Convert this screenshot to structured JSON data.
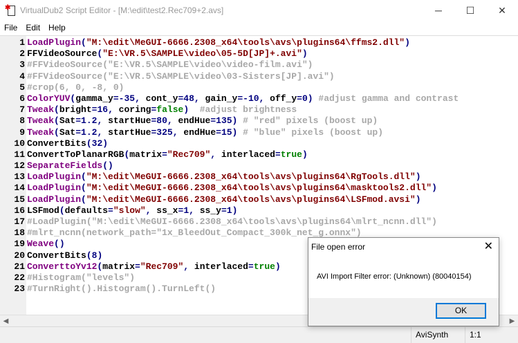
{
  "window": {
    "title": "VirtualDub2 Script Editor - [M:\\edit\\test2.Rec709+2.avs]",
    "minimize": "─",
    "maximize": "☐",
    "close": "✕"
  },
  "menu": [
    "File",
    "Edit",
    "Help"
  ],
  "lines": [
    {
      "num": "1",
      "tokens": [
        {
          "c": "fn",
          "t": "LoadPlugin"
        },
        {
          "c": "p",
          "t": "("
        },
        {
          "c": "s",
          "t": "\"M:\\edit\\MeGUI-6666.2308_x64\\tools\\avs\\plugins64\\ffms2.dll\""
        },
        {
          "c": "p",
          "t": ")"
        }
      ]
    },
    {
      "num": "2",
      "tokens": [
        {
          "c": "id",
          "t": "FFVideoSource"
        },
        {
          "c": "p",
          "t": "("
        },
        {
          "c": "s",
          "t": "\"E:\\VR.5\\SAMPLE\\video\\05-5D[JP]+.avi\""
        },
        {
          "c": "p",
          "t": ")"
        }
      ]
    },
    {
      "num": "3",
      "tokens": [
        {
          "c": "cm",
          "t": "#FFVideoSource(\"E:\\VR.5\\SAMPLE\\video\\video-film.avi\")"
        }
      ]
    },
    {
      "num": "4",
      "tokens": [
        {
          "c": "cm",
          "t": "#FFVideoSource(\"E:\\VR.5\\SAMPLE\\video\\03-Sisters[JP].avi\")"
        }
      ]
    },
    {
      "num": "5",
      "tokens": [
        {
          "c": "cm",
          "t": "#crop(6, 0, -8, 0)"
        }
      ]
    },
    {
      "num": "6",
      "tokens": [
        {
          "c": "fn",
          "t": "ColorYUV"
        },
        {
          "c": "p",
          "t": "("
        },
        {
          "c": "id",
          "t": "gamma_y"
        },
        {
          "c": "p",
          "t": "="
        },
        {
          "c": "n",
          "t": "-35"
        },
        {
          "c": "p",
          "t": ", "
        },
        {
          "c": "id",
          "t": "cont_y"
        },
        {
          "c": "p",
          "t": "="
        },
        {
          "c": "n",
          "t": "48"
        },
        {
          "c": "p",
          "t": ", "
        },
        {
          "c": "id",
          "t": "gain_y"
        },
        {
          "c": "p",
          "t": "="
        },
        {
          "c": "n",
          "t": "-10"
        },
        {
          "c": "p",
          "t": ", "
        },
        {
          "c": "id",
          "t": "off_y"
        },
        {
          "c": "p",
          "t": "="
        },
        {
          "c": "n",
          "t": "0"
        },
        {
          "c": "p",
          "t": ") "
        },
        {
          "c": "cm",
          "t": "#adjust gamma and contrast"
        }
      ]
    },
    {
      "num": "7",
      "tokens": [
        {
          "c": "fn",
          "t": "Tweak"
        },
        {
          "c": "p",
          "t": "("
        },
        {
          "c": "id",
          "t": "bright"
        },
        {
          "c": "p",
          "t": "="
        },
        {
          "c": "n",
          "t": "16"
        },
        {
          "c": "p",
          "t": ", "
        },
        {
          "c": "id",
          "t": "coring"
        },
        {
          "c": "p",
          "t": "="
        },
        {
          "c": "b",
          "t": "false"
        },
        {
          "c": "p",
          "t": ")  "
        },
        {
          "c": "cm",
          "t": "#adjust brightness"
        }
      ]
    },
    {
      "num": "8",
      "tokens": [
        {
          "c": "fn",
          "t": "Tweak"
        },
        {
          "c": "p",
          "t": "("
        },
        {
          "c": "id",
          "t": "Sat"
        },
        {
          "c": "p",
          "t": "="
        },
        {
          "c": "n",
          "t": "1.2"
        },
        {
          "c": "p",
          "t": ", "
        },
        {
          "c": "id",
          "t": "startHue"
        },
        {
          "c": "p",
          "t": "="
        },
        {
          "c": "n",
          "t": "80"
        },
        {
          "c": "p",
          "t": ", "
        },
        {
          "c": "id",
          "t": "endHue"
        },
        {
          "c": "p",
          "t": "="
        },
        {
          "c": "n",
          "t": "135"
        },
        {
          "c": "p",
          "t": ") "
        },
        {
          "c": "cm",
          "t": "# \"red\" pixels (boost up)"
        }
      ]
    },
    {
      "num": "9",
      "tokens": [
        {
          "c": "fn",
          "t": "Tweak"
        },
        {
          "c": "p",
          "t": "("
        },
        {
          "c": "id",
          "t": "Sat"
        },
        {
          "c": "p",
          "t": "="
        },
        {
          "c": "n",
          "t": "1.2"
        },
        {
          "c": "p",
          "t": ", "
        },
        {
          "c": "id",
          "t": "startHue"
        },
        {
          "c": "p",
          "t": "="
        },
        {
          "c": "n",
          "t": "325"
        },
        {
          "c": "p",
          "t": ", "
        },
        {
          "c": "id",
          "t": "endHue"
        },
        {
          "c": "p",
          "t": "="
        },
        {
          "c": "n",
          "t": "15"
        },
        {
          "c": "p",
          "t": ") "
        },
        {
          "c": "cm",
          "t": "# \"blue\" pixels (boost up)"
        }
      ]
    },
    {
      "num": "10",
      "tokens": [
        {
          "c": "id",
          "t": "ConvertBits"
        },
        {
          "c": "p",
          "t": "("
        },
        {
          "c": "n",
          "t": "32"
        },
        {
          "c": "p",
          "t": ")"
        }
      ]
    },
    {
      "num": "11",
      "tokens": [
        {
          "c": "id",
          "t": "ConvertToPlanarRGB"
        },
        {
          "c": "p",
          "t": "("
        },
        {
          "c": "id",
          "t": "matrix"
        },
        {
          "c": "p",
          "t": "="
        },
        {
          "c": "s",
          "t": "\"Rec709\""
        },
        {
          "c": "p",
          "t": ", "
        },
        {
          "c": "id",
          "t": "interlaced"
        },
        {
          "c": "p",
          "t": "="
        },
        {
          "c": "b",
          "t": "true"
        },
        {
          "c": "p",
          "t": ")"
        }
      ]
    },
    {
      "num": "12",
      "tokens": [
        {
          "c": "fn",
          "t": "SeparateFields"
        },
        {
          "c": "p",
          "t": "()"
        }
      ]
    },
    {
      "num": "13",
      "tokens": [
        {
          "c": "fn",
          "t": "LoadPlugin"
        },
        {
          "c": "p",
          "t": "("
        },
        {
          "c": "s",
          "t": "\"M:\\edit\\MeGUI-6666.2308_x64\\tools\\avs\\plugins64\\RgTools.dll\""
        },
        {
          "c": "p",
          "t": ")"
        }
      ]
    },
    {
      "num": "14",
      "tokens": [
        {
          "c": "fn",
          "t": "LoadPlugin"
        },
        {
          "c": "p",
          "t": "("
        },
        {
          "c": "s",
          "t": "\"M:\\edit\\MeGUI-6666.2308_x64\\tools\\avs\\plugins64\\masktools2.dll\""
        },
        {
          "c": "p",
          "t": ")"
        }
      ]
    },
    {
      "num": "15",
      "tokens": [
        {
          "c": "fn",
          "t": "LoadPlugin"
        },
        {
          "c": "p",
          "t": "("
        },
        {
          "c": "s",
          "t": "\"M:\\edit\\MeGUI-6666.2308_x64\\tools\\avs\\plugins64\\LSFmod.avsi\""
        },
        {
          "c": "p",
          "t": ")"
        }
      ]
    },
    {
      "num": "16",
      "tokens": [
        {
          "c": "id",
          "t": "LSFmod"
        },
        {
          "c": "p",
          "t": "("
        },
        {
          "c": "id",
          "t": "defaults"
        },
        {
          "c": "p",
          "t": "="
        },
        {
          "c": "s",
          "t": "\"slow\""
        },
        {
          "c": "p",
          "t": ", "
        },
        {
          "c": "id",
          "t": "ss_x"
        },
        {
          "c": "p",
          "t": "="
        },
        {
          "c": "n",
          "t": "1"
        },
        {
          "c": "p",
          "t": ", "
        },
        {
          "c": "id",
          "t": "ss_y"
        },
        {
          "c": "p",
          "t": "="
        },
        {
          "c": "n",
          "t": "1"
        },
        {
          "c": "p",
          "t": ")"
        }
      ]
    },
    {
      "num": "17",
      "tokens": [
        {
          "c": "cm",
          "t": "#LoadPlugin(\"M:\\edit\\MeGUI-6666.2308_x64\\tools\\avs\\plugins64\\mlrt_ncnn.dll\")"
        }
      ]
    },
    {
      "num": "18",
      "tokens": [
        {
          "c": "cm",
          "t": "#mlrt_ncnn(network_path=\"1x_BleedOut_Compact_300k_net_g.onnx\")"
        }
      ]
    },
    {
      "num": "19",
      "tokens": [
        {
          "c": "fn",
          "t": "Weave"
        },
        {
          "c": "p",
          "t": "()"
        }
      ]
    },
    {
      "num": "20",
      "tokens": [
        {
          "c": "id",
          "t": "ConvertBits"
        },
        {
          "c": "p",
          "t": "("
        },
        {
          "c": "n",
          "t": "8"
        },
        {
          "c": "p",
          "t": ")"
        }
      ]
    },
    {
      "num": "21",
      "tokens": [
        {
          "c": "fn",
          "t": "ConverttoYv12"
        },
        {
          "c": "p",
          "t": "("
        },
        {
          "c": "id",
          "t": "matrix"
        },
        {
          "c": "p",
          "t": "="
        },
        {
          "c": "s",
          "t": "\"Rec709\""
        },
        {
          "c": "p",
          "t": ", "
        },
        {
          "c": "id",
          "t": "interlaced"
        },
        {
          "c": "p",
          "t": "="
        },
        {
          "c": "b",
          "t": "true"
        },
        {
          "c": "p",
          "t": ")"
        }
      ]
    },
    {
      "num": "22",
      "tokens": [
        {
          "c": "cm",
          "t": "#Histogram(\"levels\")"
        }
      ]
    },
    {
      "num": "23",
      "tokens": [
        {
          "c": "cm",
          "t": "#TurnRight().Histogram().TurnLeft()"
        }
      ]
    }
  ],
  "scrollbar": {
    "left": "◀",
    "right": "▶"
  },
  "status": {
    "language": "AviSynth",
    "position": "1:1"
  },
  "dialog": {
    "title": "File open error",
    "close": "✕",
    "message": "AVI Import Filter error: (Unknown) (80040154)",
    "ok": "OK"
  }
}
